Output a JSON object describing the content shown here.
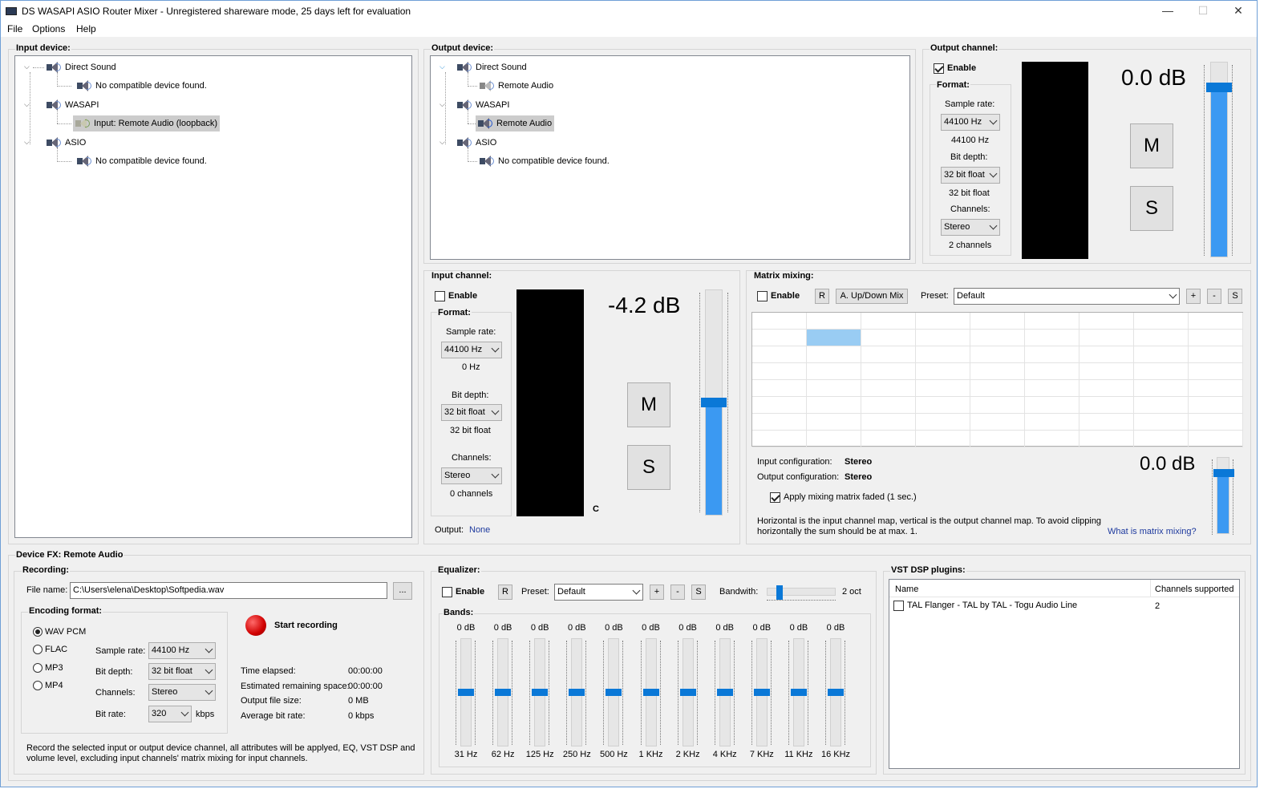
{
  "window": {
    "title": "DS WASAPI ASIO Router Mixer - Unregistered shareware mode, 25 days left for evaluation",
    "minimize": "—",
    "maximize": "☐",
    "close": "✕"
  },
  "menu": [
    "File",
    "Options",
    "Help"
  ],
  "input_device": {
    "label": "Input device:",
    "tree": [
      {
        "name": "Direct Sound",
        "child": "No compatible device found."
      },
      {
        "name": "WASAPI",
        "child": "Input: Remote Audio (loopback)"
      },
      {
        "name": "ASIO",
        "child": "No compatible device found."
      }
    ]
  },
  "output_device": {
    "label": "Output device:",
    "tree": [
      {
        "name": "Direct Sound",
        "child": "Remote Audio"
      },
      {
        "name": "WASAPI",
        "child": "Remote Audio"
      },
      {
        "name": "ASIO",
        "child": "No compatible device found."
      }
    ]
  },
  "output_channel": {
    "label": "Output channel:",
    "enable": "Enable",
    "format": "Format:",
    "sample_rate_label": "Sample rate:",
    "sample_rate": "44100 Hz",
    "sample_rate_value": "44100 Hz",
    "bit_depth_label": "Bit depth:",
    "bit_depth": "32 bit float",
    "bit_depth_value": "32 bit float",
    "channels_label": "Channels:",
    "channels": "Stereo",
    "channels_value": "2 channels",
    "db": "0.0 dB",
    "mute": "M",
    "solo": "S",
    "level": 0.87
  },
  "input_channel": {
    "label": "Input channel:",
    "enable": "Enable",
    "format": "Format:",
    "sample_rate_label": "Sample rate:",
    "sample_rate": "44100 Hz",
    "sample_rate_value": "0 Hz",
    "bit_depth_label": "Bit depth:",
    "bit_depth": "32 bit float",
    "bit_depth_value": "32 bit float",
    "channels_label": "Channels:",
    "channels": "Stereo",
    "channels_value": "0 channels",
    "db": "-4.2 dB",
    "mute": "M",
    "solo": "S",
    "meter_label": "C",
    "output_label": "Output:",
    "output_value": "None",
    "level": 0.5
  },
  "matrix": {
    "label": "Matrix mixing:",
    "enable": "Enable",
    "r": "R",
    "updown": "A. Up/Down Mix",
    "preset_label": "Preset:",
    "preset": "Default",
    "plus": "+",
    "minus": "-",
    "s": "S",
    "input_config_label": "Input configuration:",
    "input_config": "Stereo",
    "output_config_label": "Output configuration:",
    "output_config": "Stereo",
    "apply_faded": "Apply mixing matrix faded (1 sec.)",
    "help_line1": "Horizontal is the input channel map, vertical is the output channel map. To avoid clipping",
    "help_line2": "horizontally the sum should be at max. 1.",
    "what_link": "What is matrix mixing?",
    "db": "0.0 dB",
    "level": 0.8
  },
  "device_fx": {
    "label": "Device FX: Remote Audio",
    "recording": {
      "label": "Recording:",
      "file_name_label": "File name:",
      "file_name": "C:\\Users\\elena\\Desktop\\Softpedia.wav",
      "browse": "...",
      "encoding_label": "Encoding format:",
      "formats": [
        "WAV PCM",
        "FLAC",
        "MP3",
        "MP4"
      ],
      "sample_rate_label": "Sample rate:",
      "sample_rate": "44100 Hz",
      "bit_depth_label": "Bit depth:",
      "bit_depth": "32 bit float",
      "channels_label": "Channels:",
      "channels": "Stereo",
      "bit_rate_label": "Bit rate:",
      "bit_rate": "320",
      "bit_rate_unit": "kbps",
      "start": "Start recording",
      "time_elapsed_label": "Time elapsed:",
      "time_elapsed": "00:00:00",
      "remaining_label": "Estimated remaining space:",
      "remaining": "00:00:00",
      "file_size_label": "Output file size:",
      "file_size": "0 MB",
      "avg_bitrate_label": "Average bit rate:",
      "avg_bitrate": "0 kbps",
      "note_line1": "Record the selected input or output device channel, all attributes will be applyed, EQ, VST DSP and",
      "note_line2": "volume level, excluding input channels' matrix mixing for input channels."
    },
    "equalizer": {
      "label": "Equalizer:",
      "enable": "Enable",
      "r": "R",
      "preset_label": "Preset:",
      "preset": "Default",
      "plus": "+",
      "minus": "-",
      "s": "S",
      "bandwith_label": "Bandwith:",
      "bandwith": "2 oct",
      "bandwith_pos": 0.18,
      "bands_label": "Bands:",
      "bands": [
        {
          "db": "0 dB",
          "freq": "31 Hz"
        },
        {
          "db": "0 dB",
          "freq": "62 Hz"
        },
        {
          "db": "0 dB",
          "freq": "125 Hz"
        },
        {
          "db": "0 dB",
          "freq": "250 Hz"
        },
        {
          "db": "0 dB",
          "freq": "500 Hz"
        },
        {
          "db": "0 dB",
          "freq": "1 KHz"
        },
        {
          "db": "0 dB",
          "freq": "2 KHz"
        },
        {
          "db": "0 dB",
          "freq": "4 KHz"
        },
        {
          "db": "0 dB",
          "freq": "7 KHz"
        },
        {
          "db": "0 dB",
          "freq": "11 KHz"
        },
        {
          "db": "0 dB",
          "freq": "16 KHz"
        }
      ]
    },
    "vst": {
      "label": "VST DSP plugins:",
      "col_name": "Name",
      "col_channels": "Channels supported",
      "plugins": [
        {
          "name": "TAL Flanger - TAL by TAL - Togu Audio Line",
          "channels": "2"
        }
      ]
    }
  }
}
